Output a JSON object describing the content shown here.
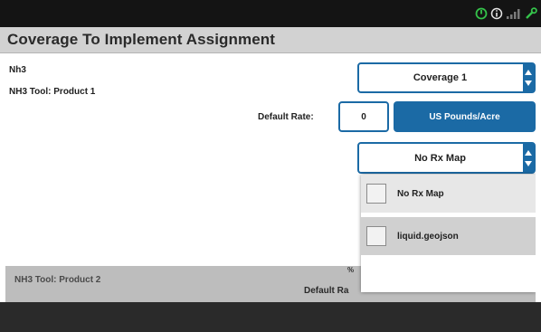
{
  "status_bar": {
    "icons": [
      "power-icon",
      "info-icon",
      "signal-bars-icon",
      "wrench-icon"
    ],
    "colors": {
      "power": "#34c24a",
      "info": "#e6e6e6",
      "signal": "#7a7a7a",
      "wrench": "#34c24a"
    }
  },
  "header": {
    "title": "Coverage To Implement Assignment"
  },
  "product1": {
    "name": "Nh3",
    "tool_label": "NH3 Tool: Product 1",
    "default_rate_label": "Default Rate:",
    "default_rate_value": "0",
    "unit_label": "US Pounds/Acre",
    "coverage_select": "Coverage 1",
    "rx_select": "No Rx Map"
  },
  "rx_dropdown": {
    "options": [
      {
        "label": "No Rx Map"
      },
      {
        "label": "liquid.geojson"
      }
    ]
  },
  "product2": {
    "tool_label": "NH3 Tool: Product 2",
    "partial_label_top": "%",
    "default_rate_partial": "Default Ra"
  },
  "theme": {
    "accent": "#1b6aa5",
    "status_bg": "#141414",
    "title_bg": "#d2d2d2",
    "footer_bg": "#2a2a2a"
  }
}
